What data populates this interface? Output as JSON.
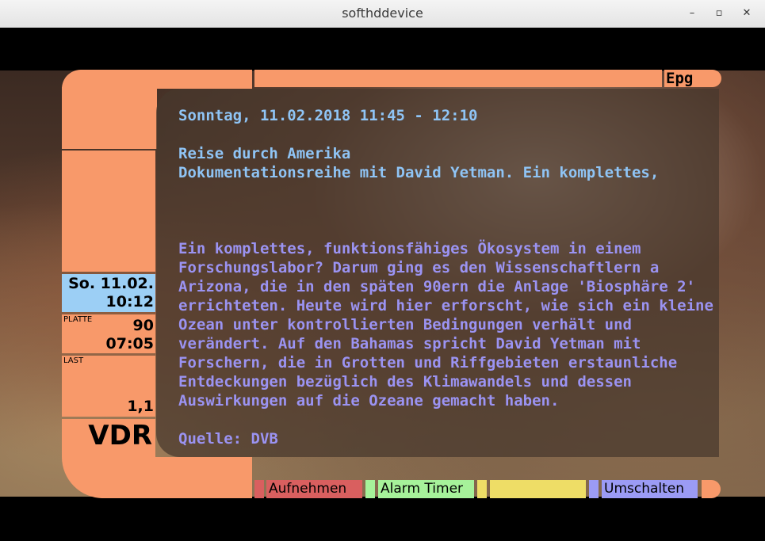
{
  "window": {
    "title": "softhddevice"
  },
  "epg": {
    "label": "Epg",
    "datetime": "Sonntag, 11.02.2018 11:45 - 12:10",
    "title": "Reise durch Amerika",
    "short_text": "Dokumentationsreihe mit David Yetman. Ein komplettes,",
    "description": [
      "Ein komplettes, funktionsfähiges Ökosystem in einem",
      "Forschungslabor? Darum ging es den Wissenschaftlern a",
      "Arizona, die in den späten 90ern die Anlage 'Biosphäre 2'",
      "errichteten. Heute wird hier erforscht, wie sich ein kleine",
      "Ozean unter kontrollierten Bedingungen verhält und",
      "verändert. Auf den Bahamas spricht David Yetman mit",
      "Forschern, die in Grotten und Riffgebieten erstaunliche",
      "Entdeckungen bezüglich des Klimawandels und dessen",
      "Auswirkungen auf die Ozeane gemacht haben."
    ],
    "source": "Quelle: DVB"
  },
  "sidebar": {
    "date": "So. 11.02.",
    "time": "10:12",
    "disk_label": "PLATTE",
    "disk_percent": "90",
    "disk_time": "07:05",
    "load_label": "LAST",
    "load_value": "1,1",
    "logo": "VDR"
  },
  "buttons": {
    "red": "Aufnehmen",
    "green": "Alarm Timer",
    "yellow": "",
    "blue": "Umschalten"
  },
  "colors": {
    "frame": "#f8996a",
    "red": "#d95f5f",
    "green": "#a6f29a",
    "yellow": "#eedd66",
    "blue": "#9b9bf5",
    "date_box": "#9ccff5",
    "text_blue": "#8fc4f5",
    "text_violet": "#9b93f2"
  }
}
